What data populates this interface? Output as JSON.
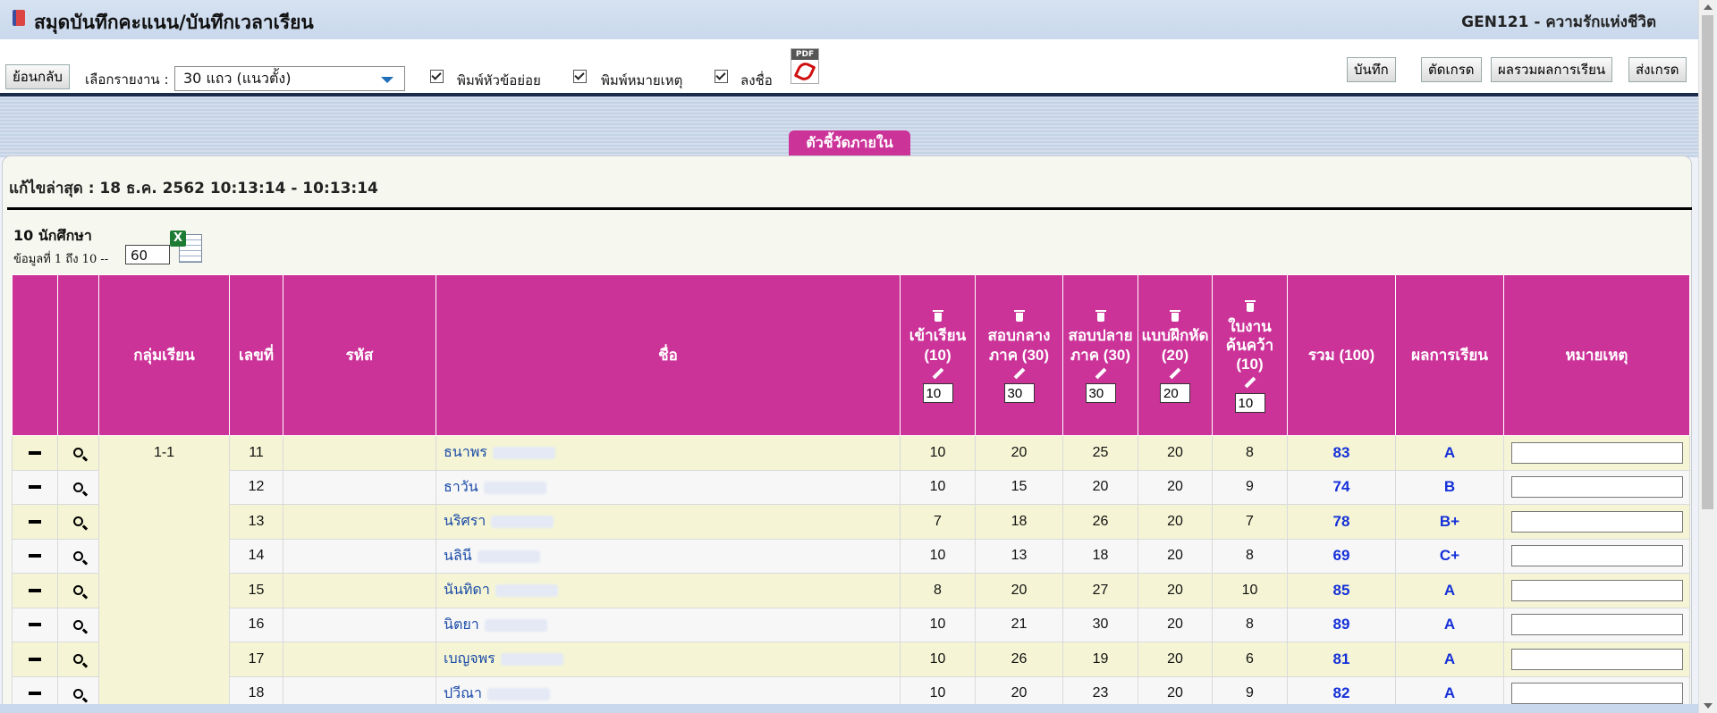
{
  "header": {
    "title": "สมุดบันทึกคะแนน/บันทึกเวลาเรียน",
    "course": "GEN121 - ความรักแห่งชีวิต"
  },
  "toolbar": {
    "back_label": "ย้อนกลับ",
    "report_label": "เลือกรายงาน :",
    "report_value": "30 แถว (แนวตั้ง)",
    "print_subtopics": "พิมพ์หัวข้อย่อย",
    "print_notes": "พิมพ์หมายเหตุ",
    "sign": "ลงชื่อ",
    "pdf_label": "PDF",
    "save_label": "บันทึก",
    "cut_grade_label": "ตัดเกรด",
    "summary_label": "ผลรวมผลการเรียน",
    "submit_grade_label": "ส่งเกรด"
  },
  "tab": {
    "label": "ตัวชี้วัดภายใน"
  },
  "panel": {
    "last_edited": "แก้ไขล่าสุด : 18 ธ.ค. 2562 10:13:14 - 10:13:14",
    "student_count": "10 นักศึกษา",
    "range": "ข้อมูลที่ 1 ถึง 10 --",
    "per_page": "60"
  },
  "table": {
    "headers": {
      "group": "กลุ่มเรียน",
      "number": "เลขที่",
      "code": "รหัส",
      "name": "ชื่อ",
      "attend": "เข้าเรียน (10)",
      "midterm": "สอบกลางภาค (30)",
      "final": "สอบปลายภาค (30)",
      "exercise": "แบบฝึกหัด (20)",
      "research": "ใบงานค้นคว้า (10)",
      "total": "รวม (100)",
      "grade": "ผลการเรียน",
      "note": "หมายเหตุ"
    },
    "max_scores": {
      "attend": "10",
      "midterm": "30",
      "final": "30",
      "exercise": "20",
      "research": "10"
    },
    "group_value": "1-1",
    "rows": [
      {
        "no": "11",
        "name": "ธนาพร",
        "attend": "10",
        "midterm": "20",
        "final": "25",
        "exercise": "20",
        "research": "8",
        "total": "83",
        "grade": "A"
      },
      {
        "no": "12",
        "name": "ธาวัน",
        "attend": "10",
        "midterm": "15",
        "final": "20",
        "exercise": "20",
        "research": "9",
        "total": "74",
        "grade": "B"
      },
      {
        "no": "13",
        "name": "นริศรา",
        "attend": "7",
        "midterm": "18",
        "final": "26",
        "exercise": "20",
        "research": "7",
        "total": "78",
        "grade": "B+"
      },
      {
        "no": "14",
        "name": "นลินี",
        "attend": "10",
        "midterm": "13",
        "final": "18",
        "exercise": "20",
        "research": "8",
        "total": "69",
        "grade": "C+"
      },
      {
        "no": "15",
        "name": "นันทิดา",
        "attend": "8",
        "midterm": "20",
        "final": "27",
        "exercise": "20",
        "research": "10",
        "total": "85",
        "grade": "A"
      },
      {
        "no": "16",
        "name": "นิตยา",
        "attend": "10",
        "midterm": "21",
        "final": "30",
        "exercise": "20",
        "research": "8",
        "total": "89",
        "grade": "A"
      },
      {
        "no": "17",
        "name": "เบญจพร",
        "attend": "10",
        "midterm": "26",
        "final": "19",
        "exercise": "20",
        "research": "6",
        "total": "81",
        "grade": "A"
      },
      {
        "no": "18",
        "name": "ปวีณา",
        "attend": "10",
        "midterm": "20",
        "final": "23",
        "exercise": "20",
        "research": "9",
        "total": "82",
        "grade": "A"
      }
    ]
  },
  "colors": {
    "header_bg": "#cc3399",
    "accent_blue": "#1530d8",
    "row_odd": "#f5f5d5",
    "row_even": "#f7f7f7"
  }
}
